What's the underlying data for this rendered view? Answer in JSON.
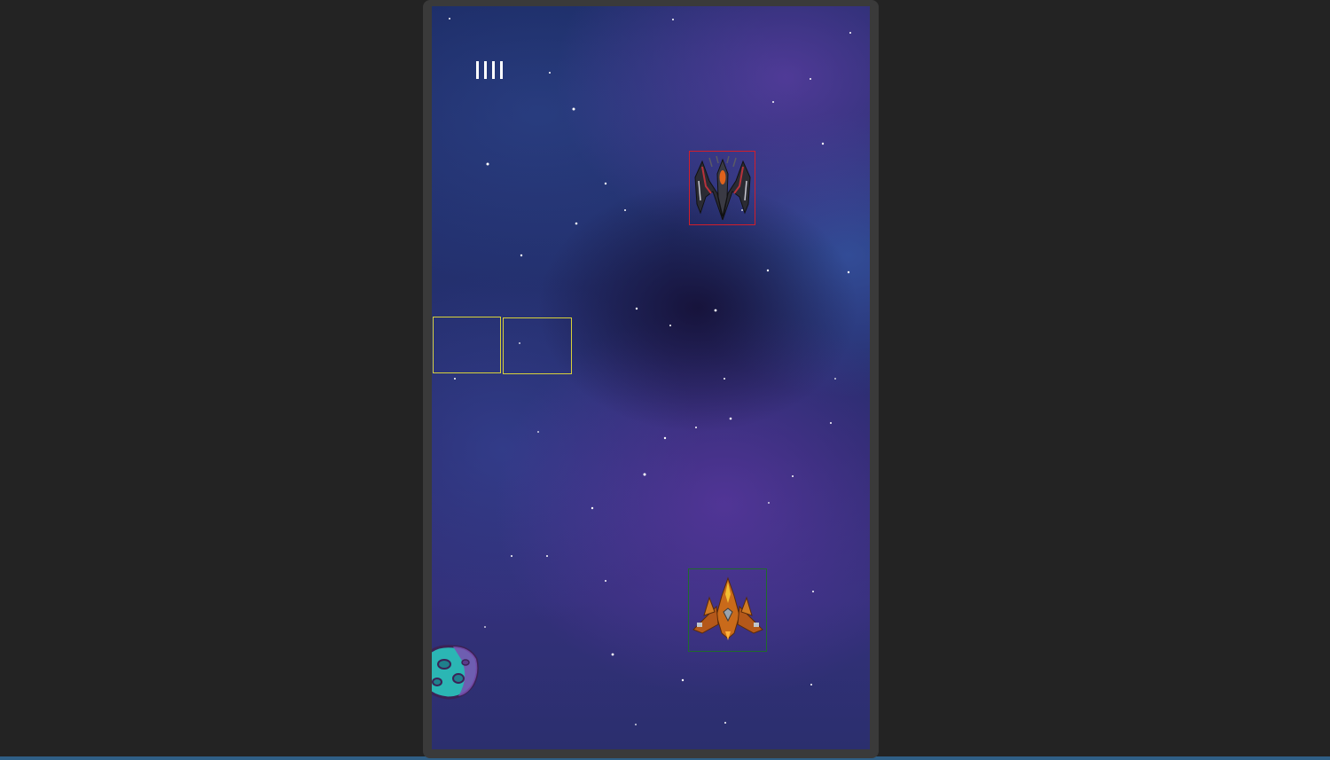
{
  "game": {
    "lives": 4,
    "entities": {
      "enemy": "enemy-ship",
      "player": "player-ship",
      "hazard": "asteroid"
    },
    "colors": {
      "enemy_hitbox": "#d21e2a",
      "player_hitbox": "#1f6b2c",
      "target_hitbox": "#d9d23a",
      "background": "#232323"
    }
  }
}
